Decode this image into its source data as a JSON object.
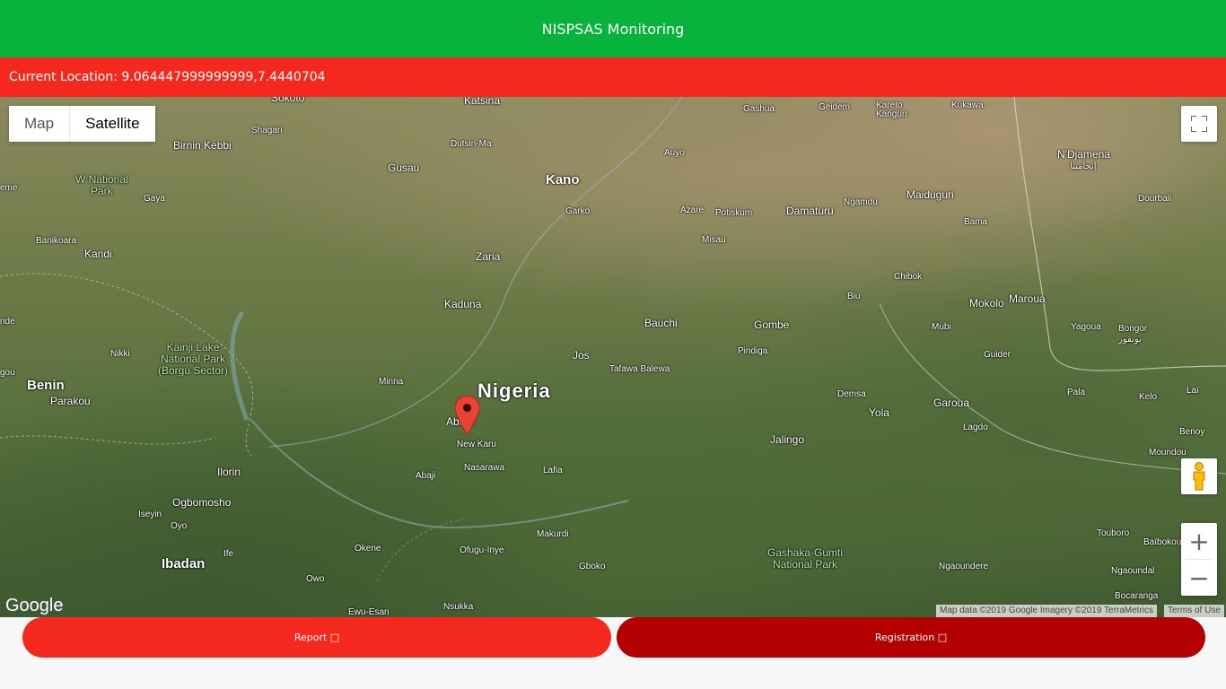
{
  "header": {
    "title": "NISPSAS Monitoring"
  },
  "location": {
    "text": "Current Location: 9.064447999999999,7.4440704"
  },
  "map": {
    "type_control": {
      "map_label": "Map",
      "satellite_label": "Satellite",
      "selected": "Satellite"
    },
    "zoom": {
      "in_label": "+",
      "out_label": "−"
    },
    "logo": "Google",
    "attribution": "Map data ©2019 Google Imagery ©2019 TerraMetrics",
    "terms": "Terms of Use",
    "places": {
      "sokoto": "Sokoto",
      "katsina": "Katsina",
      "gashua": "Gashua",
      "geidem": "Geidem",
      "karetokanguri": "Kareto\nKanguri",
      "kukawa": "Kukawa",
      "birnin_kebbi": "Birnin Kebbi",
      "shagari": "Shagari",
      "dutsin_ma": "Dutsin-Ma",
      "ndjamena": "N'Djamena",
      "ndjamena_ar": "إنجامينا",
      "gusau": "Gusau",
      "kano": "Kano",
      "ayuo": "Auyo",
      "w_national_park": "W National\nPark",
      "gaya": "Gaya",
      "garko": "Garko",
      "azare": "Azare",
      "potiskum": "Potiskum",
      "damaturu": "Damaturu",
      "ngamdu": "Ngamdu",
      "maiduguri": "Maiduguri",
      "dourbali": "Dourbali",
      "banikoara": "Banikoara",
      "kandi": "Kandi",
      "misau": "Misau",
      "bama": "Bama",
      "zaria": "Zaria",
      "chibok": "Chibok",
      "kaduna": "Kaduna",
      "biu": "Biu",
      "mokolo": "Mokolo",
      "maroua": "Maroua",
      "bauchi": "Bauchi",
      "gombe": "Gombe",
      "mubi": "Mubi",
      "yagoua": "Yagoua",
      "bongor": "Bongor",
      "bongor_ar": "بونقور",
      "nikki": "Nikki",
      "kainji": "Kainji Lake\nNational Park\n(Borgu Sector)",
      "jos": "Jos",
      "pindiga": "Pindiga",
      "guider": "Guider",
      "benin": "Benin",
      "parakou": "Parakou",
      "minna": "Minna",
      "nigeria": "Nigeria",
      "tafawa_balewa": "Tafawa Balewa",
      "demsa": "Demsa",
      "garoua": "Garoua",
      "pala": "Pala",
      "kelo": "Kelo",
      "abuja": "Abuja",
      "new_karu": "New Karu",
      "yola": "Yola",
      "lagdo": "Lagdo",
      "lai": "Laï",
      "jalingo": "Jalingo",
      "benoy": "Benoy",
      "ilorin": "Ilorin",
      "abaji": "Abaji",
      "nasarawa": "Nasarawa",
      "lafia": "Lafia",
      "moundou": "Moundou",
      "ogbomosho": "Ogbomosho",
      "iseyin": "Iseyin",
      "oyo": "Oyo",
      "makurdi": "Makurdi",
      "touboro": "Touboro",
      "baibokoum": "Baïbokoum",
      "okene": "Okene",
      "ofugu": "Ofugu-Inye",
      "gashaka": "Gashaka-Gumti\nNational Park",
      "ife": "Ife",
      "ibadan": "Ibadan",
      "gboko": "Gboko",
      "ngaoundere": "Ngaoundere",
      "ngaoundal": "Ngaoundal",
      "owo": "Owo",
      "bocaranga": "Bocaranga",
      "ewu_esan": "Ewu-Esan",
      "nsukka": "Nsukka",
      "gou": "gou",
      "nde": "nde",
      "eme": "eme"
    }
  },
  "actions": {
    "report_label": "Report □",
    "registration_label": "Registration □"
  },
  "colors": {
    "header": "#07b33b",
    "location_bar": "#f5281e",
    "report": "#f5281e",
    "registration": "#b30000"
  }
}
